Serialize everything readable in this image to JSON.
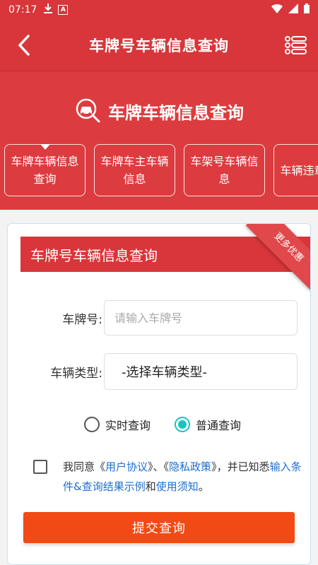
{
  "status_bar": {
    "time": "07:17",
    "download_icon": "download-icon",
    "a_icon": "A"
  },
  "header": {
    "title": "车牌号车辆信息查询"
  },
  "banner": {
    "title": "车牌车辆信息查询",
    "tabs": [
      {
        "label": "车牌车辆信息查询",
        "active": true
      },
      {
        "label": "车牌车主车辆信息",
        "active": false
      },
      {
        "label": "车架号车辆信息",
        "active": false
      },
      {
        "label": "车辆违章录查",
        "active": false
      }
    ]
  },
  "form": {
    "card_title": "车牌号车辆信息查询",
    "ribbon": "更多优惠",
    "plate_label": "车牌号:",
    "plate_placeholder": "请输入车牌号",
    "type_label": "车辆类型:",
    "type_value": "-选择车辆类型-",
    "radio_realtime": "实时查询",
    "radio_normal": "普通查询",
    "agree_prefix": "我同意《",
    "agree_user": "用户协议",
    "agree_mid1": "》、《",
    "agree_privacy": "隐私政策",
    "agree_mid2": "》，并已知悉",
    "agree_conditions": "输入条件&查询结果示例",
    "agree_and": "和",
    "agree_notice": "使用须知",
    "agree_end": "。",
    "submit": "提交查询"
  },
  "colors": {
    "primary_red": "#d8363a",
    "submit_orange": "#f14a14",
    "radio_teal": "#17c5c0",
    "link_blue": "#1d6fd1"
  }
}
